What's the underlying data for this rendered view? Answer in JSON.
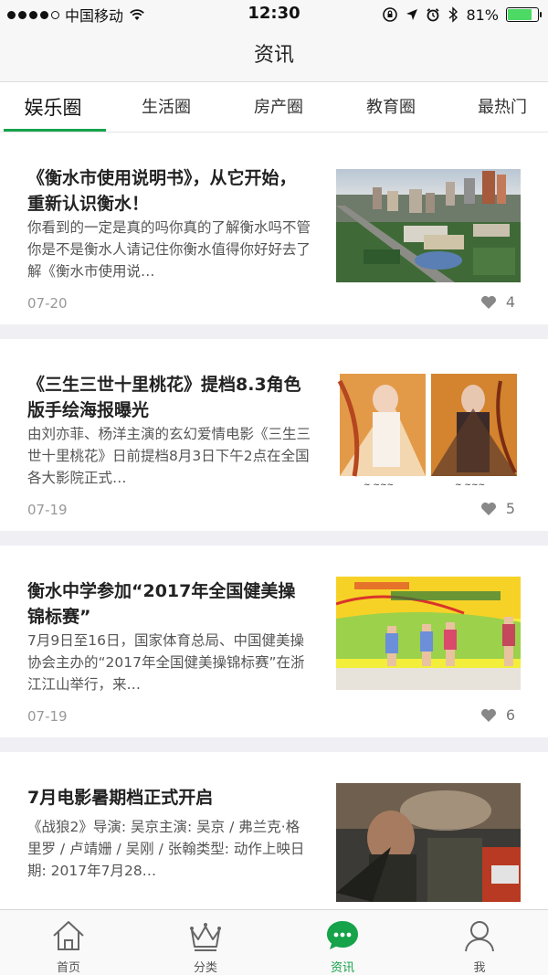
{
  "status_bar": {
    "carrier": "中国移动",
    "time": "12:30",
    "battery": "81%",
    "battery_level": 0.81,
    "signal_bars": 4,
    "icons": [
      "signal-dots-icon",
      "wifi-icon",
      "rotation-lock-icon",
      "location-icon",
      "alarm-icon",
      "bluetooth-icon",
      "battery-icon"
    ]
  },
  "nav": {
    "title": "资讯"
  },
  "tabs": [
    {
      "label": "娱乐圈",
      "active": true
    },
    {
      "label": "生活圈",
      "active": false
    },
    {
      "label": "房产圈",
      "active": false
    },
    {
      "label": "教育圈",
      "active": false
    },
    {
      "label": "最热门",
      "active": false
    }
  ],
  "articles": [
    {
      "title": "《衡水市使用说明书》，从它开始，重新认识衡水！",
      "desc": "你看到的一定是真的吗你真的了解衡水吗不管你是不是衡水人请记住你衡水值得你好好去了解《衡水市使用说…",
      "date": "07-20",
      "likes": "4",
      "image": "city-aerial-photo"
    },
    {
      "title": "《三生三世十里桃花》提档8.3角色版手绘海报曝光",
      "desc": "由刘亦菲、杨洋主演的玄幻爱情电影《三生三世十里桃花》日前提档8月3日下午2点在全国各大影院正式…",
      "date": "07-19",
      "likes": "5",
      "image": "movie-posters-photo"
    },
    {
      "title": "衡水中学参加“2017年全国健美操锦标赛”",
      "desc": "7月9日至16日，国家体育总局、中国健美操协会主办的“2017年全国健美操锦标赛”在浙江江山举行，来…",
      "date": "07-19",
      "likes": "6",
      "image": "aerobics-competition-photo"
    },
    {
      "title": "7月电影暑期档正式开启",
      "desc": "《战狼2》导演: 吴京主演: 吴京 / 弗兰克·格里罗 / 卢靖姗 / 吴刚 / 张翰类型: 动作上映日期: 2017年7月28…",
      "date": "",
      "likes": "",
      "image": "war-movie-poster-photo"
    }
  ],
  "tab_bar": [
    {
      "label": "首页",
      "icon": "home-icon",
      "active": false
    },
    {
      "label": "分类",
      "icon": "crown-icon",
      "active": false
    },
    {
      "label": "资讯",
      "icon": "chat-bubble-icon",
      "active": true
    },
    {
      "label": "我",
      "icon": "person-icon",
      "active": false
    }
  ],
  "colors": {
    "accent": "#16a34a",
    "background": "#efeff4"
  }
}
